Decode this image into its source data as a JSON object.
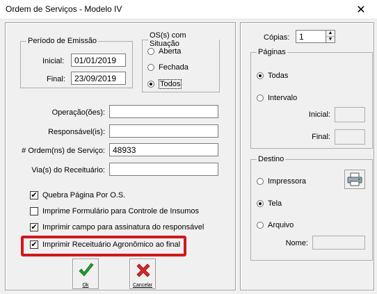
{
  "window": {
    "title": "Ordem de Serviços - Modelo IV",
    "close_symbol": "✕"
  },
  "periodo": {
    "legend": "Período de Emissão",
    "inicial_label": "Inicial:",
    "inicial_value": "01/01/2019",
    "final_label": "Final:",
    "final_value": "23/09/2019"
  },
  "situacao": {
    "legend": "OS(s) com Situação",
    "options": [
      "Aberta",
      "Fechada",
      "Todos"
    ],
    "selected": "Todos"
  },
  "fields": {
    "operacao_label": "Operação(ões):",
    "operacao_value": "",
    "responsavel_label": "Responsável(is):",
    "responsavel_value": "",
    "ordem_label": "# Ordem(ns) de Serviço:",
    "ordem_value": "48933",
    "via_label": "Via(s) do Receituário:",
    "via_value": ""
  },
  "checks": [
    {
      "label": "Quebra Página Por O.S.",
      "checked": true
    },
    {
      "label": "Imprime Formulário para Controle de Insumos",
      "checked": false
    },
    {
      "label": "Imprimir campo para assinatura do responsável",
      "checked": true
    },
    {
      "label": "Imprimir Receituário Agronômico ao final",
      "checked": true
    }
  ],
  "check_mark": "✔",
  "buttons": {
    "ok_label": "Ok",
    "cancel_label": "Cancelar"
  },
  "copias": {
    "label": "Cópias:",
    "value": "1"
  },
  "paginas": {
    "legend": "Páginas",
    "todas_label": "Todas",
    "intervalo_label": "Intervalo",
    "selected": "Todas",
    "inicial_label": "Inicial:",
    "final_label": "Final:"
  },
  "destino": {
    "legend": "Destino",
    "impressora_label": "Impressora",
    "tela_label": "Tela",
    "arquivo_label": "Arquivo",
    "selected": "Tela",
    "nome_label": "Nome:"
  },
  "colors": {
    "highlight_frame": "#d0191e",
    "ok_green": "#1e9e2e",
    "cancel_red": "#d92626"
  }
}
